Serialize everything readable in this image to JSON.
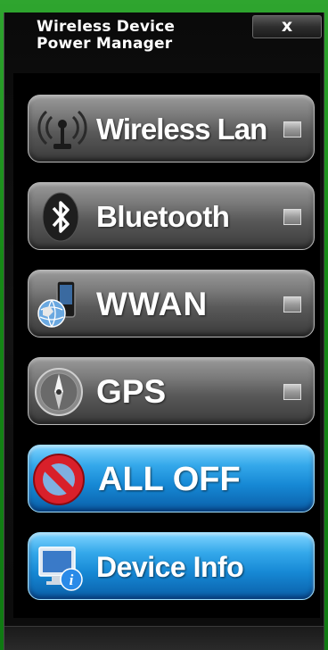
{
  "window": {
    "title": "Wireless Device\nPower Manager",
    "close_label": "x"
  },
  "buttons": [
    {
      "label": "Wireless Lan",
      "icon": "wireless-antenna-icon",
      "toggle_checked": false
    },
    {
      "label": "Bluetooth",
      "icon": "bluetooth-icon",
      "toggle_checked": false
    },
    {
      "label": "WWAN",
      "icon": "wwan-phone-globe-icon",
      "toggle_checked": false
    },
    {
      "label": "GPS",
      "icon": "compass-icon",
      "toggle_checked": false
    },
    {
      "label": "ALL OFF",
      "icon": "no-entry-icon"
    },
    {
      "label": "Device Info",
      "icon": "monitor-info-icon"
    }
  ],
  "colors": {
    "frame_green": "#1d8a1d",
    "window_bg": "#0a0a0a",
    "gray_button": "#6a6a6a",
    "blue_button": "#1688d4",
    "no_entry_red": "#d8202a"
  }
}
